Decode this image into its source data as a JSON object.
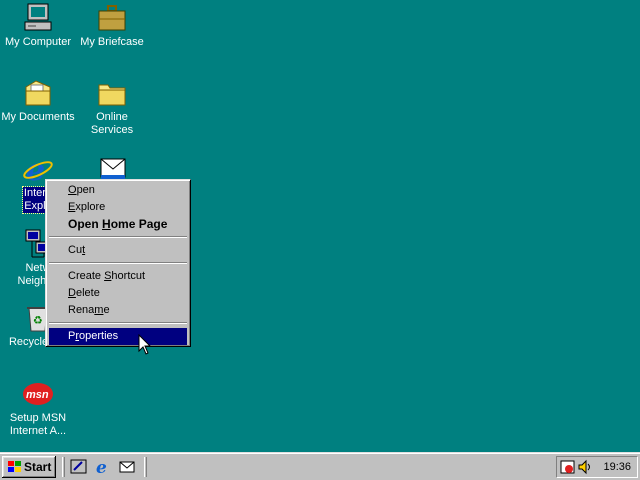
{
  "desktop": {
    "background": "#008080",
    "icons": [
      {
        "label": "My Computer",
        "icon": "my-computer-icon"
      },
      {
        "label": "My Briefcase",
        "icon": "briefcase-icon"
      },
      {
        "label": "My Documents",
        "icon": "my-documents-folder-icon"
      },
      {
        "label": "Online\nServices",
        "icon": "folder-icon"
      },
      {
        "label": "Intern\nExplo",
        "icon": "internet-explorer-icon",
        "selected": true
      },
      {
        "label": "",
        "icon": "outlook-express-icon"
      },
      {
        "label": "Netw\nNeighbo",
        "icon": "network-neighborhood-icon"
      },
      {
        "label": "Recycle Bin",
        "icon": "recycle-bin-icon"
      },
      {
        "label": "Setup MSN\nInternet A...",
        "icon": "msn-icon"
      }
    ]
  },
  "context_menu": {
    "items": [
      {
        "label": "Open",
        "accel": "O"
      },
      {
        "label": "Explore",
        "accel": "E"
      },
      {
        "label": "Open Home Page",
        "accel": "H",
        "default": true
      },
      {
        "label": "Cut",
        "accel": "t"
      },
      {
        "label": "Create Shortcut",
        "accel": "S"
      },
      {
        "label": "Delete",
        "accel": "D"
      },
      {
        "label": "Rename",
        "accel": "m"
      },
      {
        "label": "Properties",
        "accel": "r",
        "highlighted": true
      }
    ]
  },
  "taskbar": {
    "start_label": "Start",
    "quick_launch": [
      "show-desktop-icon",
      "internet-explorer-icon",
      "outlook-express-icon"
    ],
    "tray": {
      "icons": [
        "scheduler-icon",
        "volume-icon"
      ],
      "clock": "19:36"
    }
  },
  "colors": {
    "menu_face": "#c0c0c0",
    "highlight": "#000080",
    "desktop": "#008080"
  }
}
